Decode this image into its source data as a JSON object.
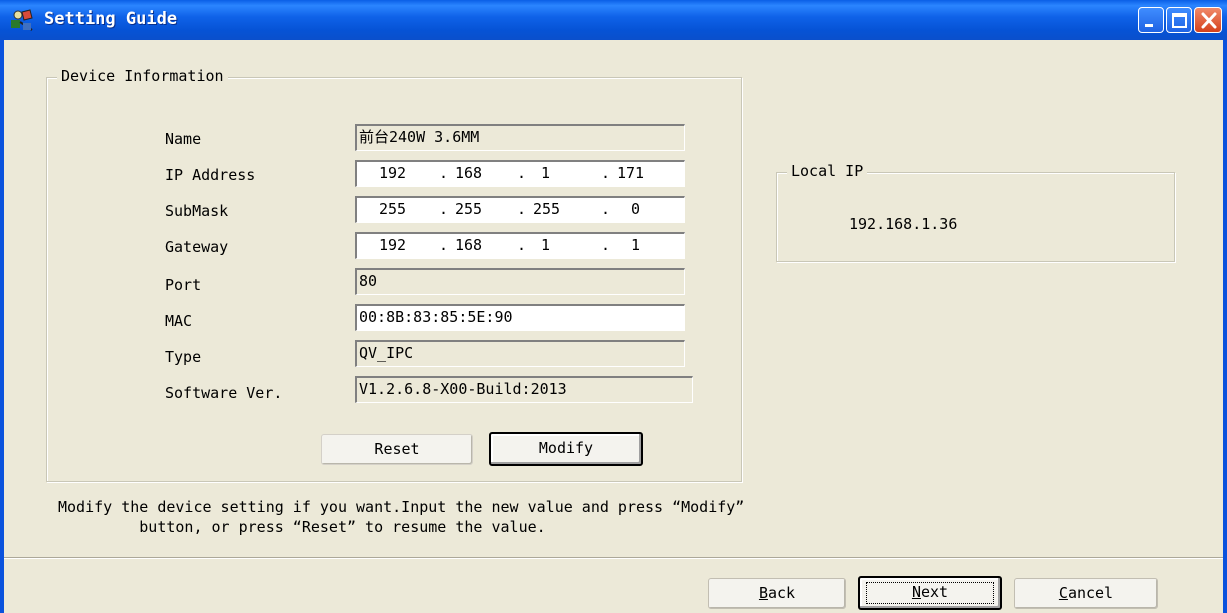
{
  "window": {
    "title": "Setting Guide",
    "icon": "setup-wizard-icon",
    "titlebar_color": "#0a52dd"
  },
  "device_info": {
    "group_title": "Device Information",
    "fields": {
      "name": {
        "label": "Name",
        "value": "前台240W 3.6MM"
      },
      "ip": {
        "label": "IP Address",
        "octets": [
          "192",
          "168",
          "1",
          "171"
        ]
      },
      "submask": {
        "label": "SubMask",
        "octets": [
          "255",
          "255",
          "255",
          "0"
        ]
      },
      "gateway": {
        "label": "Gateway",
        "octets": [
          "192",
          "168",
          "1",
          "1"
        ]
      },
      "port": {
        "label": "Port",
        "value": "80"
      },
      "mac": {
        "label": "MAC",
        "value": "00:8B:83:85:5E:90"
      },
      "type": {
        "label": "Type",
        "value": "QV_IPC"
      },
      "software": {
        "label": "Software Ver.",
        "value": "V1.2.6.8-X00-Build:2013"
      }
    },
    "reset_label": "Reset",
    "modify_label": "Modify"
  },
  "local_ip": {
    "group_title": "Local IP",
    "value": "192.168.1.36"
  },
  "hint": {
    "line1": "Modify the device setting if you want.Input the new value and press “Modify”",
    "line2": "         button, or press “Reset” to resume the value."
  },
  "footer": {
    "back_mnemonic": "B",
    "back_rest": "ack",
    "next_mnemonic": "N",
    "next_rest": "ext",
    "cancel_mnemonic": "C",
    "cancel_rest": "ancel"
  }
}
